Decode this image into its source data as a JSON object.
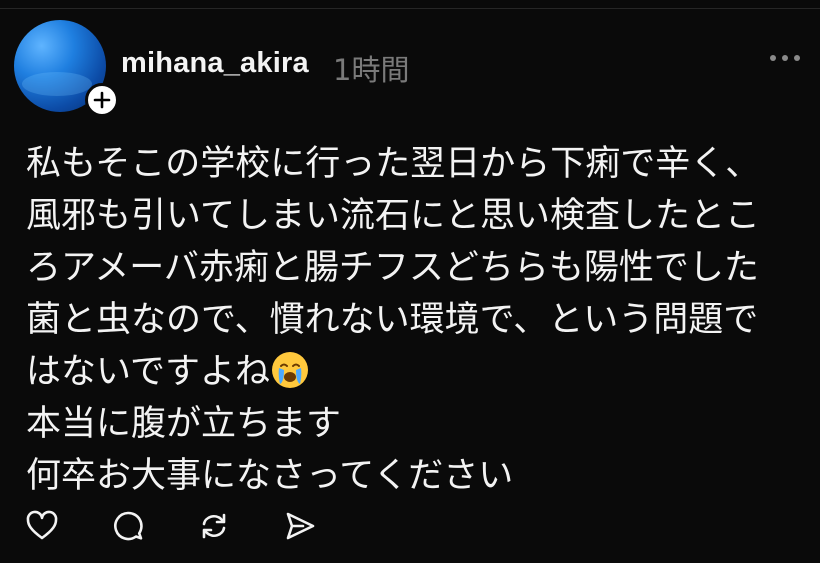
{
  "post": {
    "username": "mihana_akira",
    "timestamp": "1時間",
    "lines": [
      "私もそこの学校に行った翌日から下痢で辛く、",
      "風邪も引いてしまい流石にと思い検査したとこ",
      "ろアメーバ赤痢と腸チフスどちらも陽性でした",
      "菌と虫なので、慣れない環境で、という問題で",
      "はないですよね",
      "本当に腹が立ちます",
      "何卒お大事になさってください"
    ],
    "emoji": "crying-face"
  },
  "icons": {
    "avatar_badge": "plus-icon",
    "more": "more-options-icon",
    "actions": [
      "heart-icon",
      "comment-icon",
      "repost-icon",
      "share-icon"
    ]
  },
  "colors": {
    "background": "#0a0a0a",
    "text": "#f3f3f3",
    "muted": "#7a7a7a"
  }
}
